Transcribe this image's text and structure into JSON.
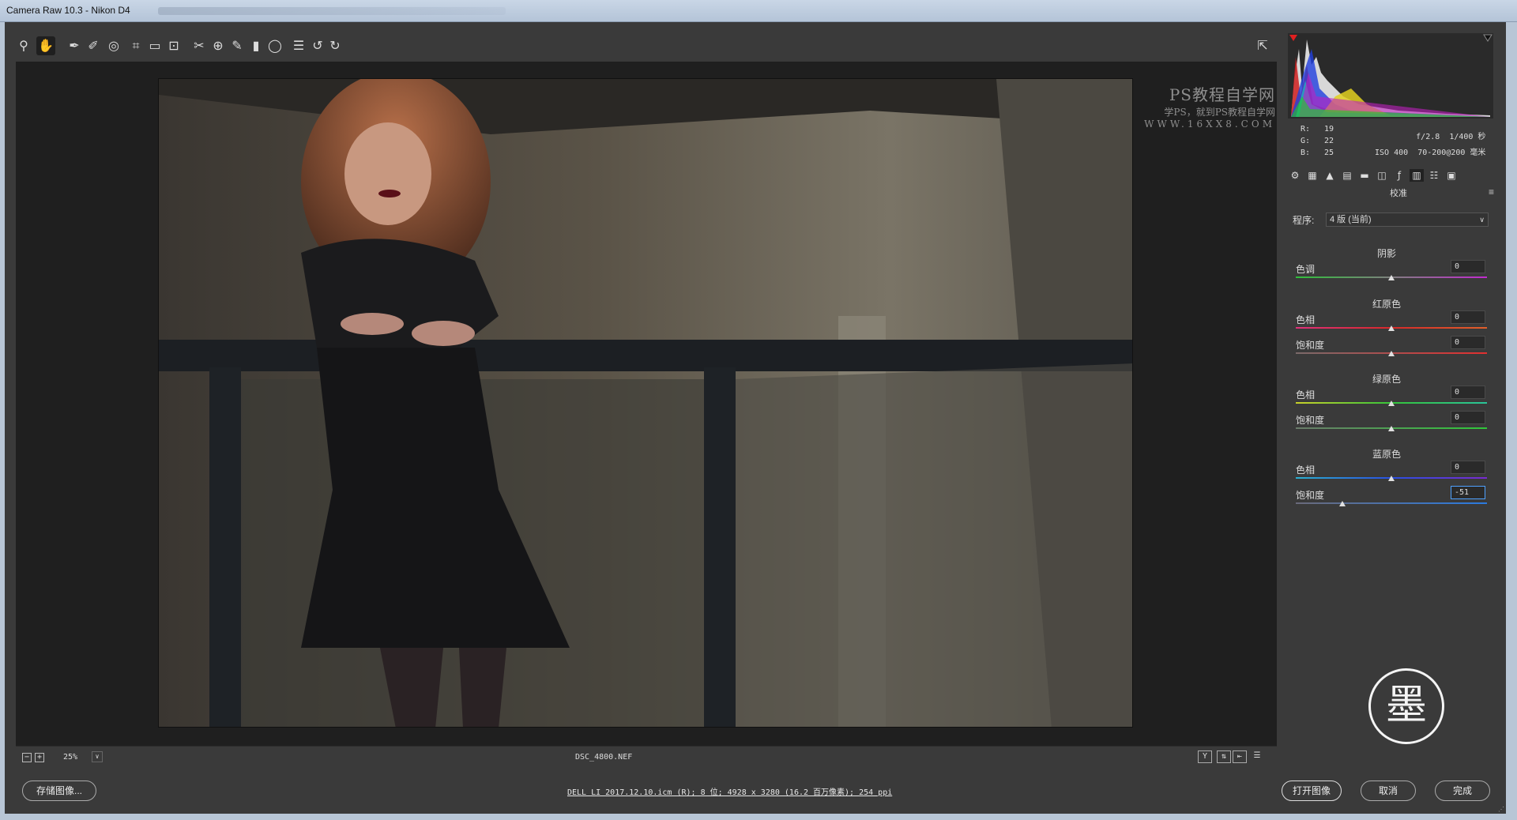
{
  "window": {
    "title": "Camera Raw 10.3 -  Nikon D4"
  },
  "toolbar": {
    "tools": [
      {
        "name": "zoom-tool",
        "glyph": "⚲"
      },
      {
        "name": "hand-tool",
        "glyph": "✋"
      },
      {
        "name": "white-balance-tool",
        "glyph": "✒"
      },
      {
        "name": "color-sampler-tool",
        "glyph": "✐"
      },
      {
        "name": "targeted-adjustment-tool",
        "glyph": "◎"
      },
      {
        "name": "crop-tool",
        "glyph": "⌗"
      },
      {
        "name": "straighten-tool",
        "glyph": "▭"
      },
      {
        "name": "transform-tool",
        "glyph": "⊡"
      },
      {
        "name": "spot-removal-tool",
        "glyph": "✂"
      },
      {
        "name": "red-eye-tool",
        "glyph": "⊕"
      },
      {
        "name": "adjustment-brush-tool",
        "glyph": "✎"
      },
      {
        "name": "graduated-filter-tool",
        "glyph": "▮"
      },
      {
        "name": "radial-filter-tool",
        "glyph": "◯"
      },
      {
        "name": "preferences-tool",
        "glyph": "☰"
      },
      {
        "name": "rotate-left-tool",
        "glyph": "↺"
      },
      {
        "name": "rotate-right-tool",
        "glyph": "↻"
      }
    ],
    "fullscreen_glyph": "⇱"
  },
  "watermark": {
    "line1": "PS教程自学网",
    "line2": "学PS，就到PS教程自学网",
    "line3": "WWW.16XX8.COM"
  },
  "status": {
    "zoom": "25%",
    "filename": "DSC_4800.NEF"
  },
  "bottom": {
    "save_label": "存储图像...",
    "workflow": "DELL LI 2017.12.10.icm (R); 8 位; 4928 x 3280 (16.2 百万像素); 254 ppi",
    "open_label": "打开图像",
    "cancel_label": "取消",
    "done_label": "完成"
  },
  "readout": {
    "r_label": "R:",
    "r": "19",
    "g_label": "G:",
    "g": "22",
    "b_label": "B:",
    "b": "25"
  },
  "exif": {
    "aperture": "f/2.8",
    "shutter": "1/400 秒",
    "iso": "ISO 400",
    "lens": "70-200@200 毫米"
  },
  "panel": {
    "title": "校准",
    "process_label": "程序:",
    "process_value": "4 版 (当前)",
    "sections": [
      {
        "title": "阴影",
        "rows": [
          {
            "label": "色调",
            "value": "0",
            "position": 0.5,
            "track": "linear-gradient(90deg,#2fbf3a,#7f7f7f,#c22bd0)"
          }
        ]
      },
      {
        "title": "红原色",
        "rows": [
          {
            "label": "色相",
            "value": "0",
            "position": 0.5,
            "track": "linear-gradient(90deg,#e0307a,#d62a2a,#e0602a)"
          },
          {
            "label": "饱和度",
            "value": "0",
            "position": 0.5,
            "track": "linear-gradient(90deg,#7a6a6a,#e23030)"
          }
        ]
      },
      {
        "title": "绿原色",
        "rows": [
          {
            "label": "色相",
            "value": "0",
            "position": 0.5,
            "track": "linear-gradient(90deg,#c8d12a,#35c43a,#2ac49a)"
          },
          {
            "label": "饱和度",
            "value": "0",
            "position": 0.5,
            "track": "linear-gradient(90deg,#6a7a6a,#30c83a)"
          }
        ]
      },
      {
        "title": "蓝原色",
        "rows": [
          {
            "label": "色相",
            "value": "0",
            "position": 0.5,
            "track": "linear-gradient(90deg,#2ab0d0,#2a50e0,#7a2ad0)"
          },
          {
            "label": "饱和度",
            "value": "-51",
            "position": 0.245,
            "track": "linear-gradient(90deg,#6a6a7a,#2a7ae0)",
            "focused": true
          }
        ]
      }
    ]
  },
  "seal": {
    "char": "墨"
  },
  "colors": {
    "background": "#3a3a3a",
    "canvas": "#1f1f1f",
    "focus": "#4ea1ff"
  }
}
